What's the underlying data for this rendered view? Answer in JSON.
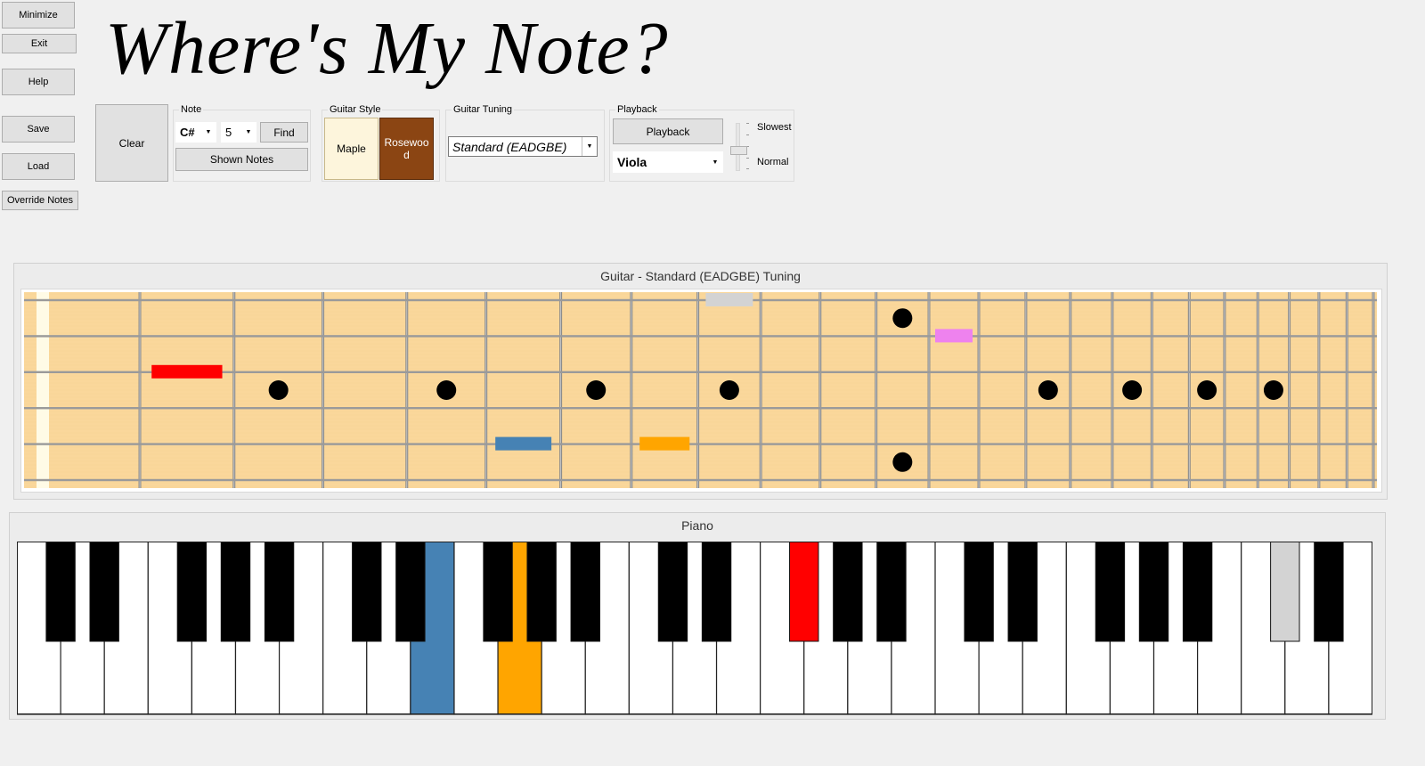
{
  "app_title": "Where's My Note?",
  "side_buttons": {
    "minimize": "Minimize",
    "exit": "Exit",
    "help": "Help",
    "save": "Save",
    "load": "Load",
    "override": "Override Notes"
  },
  "clear_label": "Clear",
  "note_group": {
    "label": "Note",
    "note_value": "C#",
    "octave_value": "5",
    "find_label": "Find",
    "shown_notes_label": "Shown Notes"
  },
  "guitar_style": {
    "label": "Guitar Style",
    "maple_label": "Maple",
    "rosewood_label": "Rosewoo d",
    "maple_color": "#fdf5dc",
    "rosewood_color": "#8b4513"
  },
  "guitar_tuning": {
    "label": "Guitar Tuning",
    "value": "Standard (EADGBE)"
  },
  "playback": {
    "label": "Playback",
    "button_label": "Playback",
    "instrument": "Viola",
    "speed_top": "Slowest",
    "speed_bottom": "Normal",
    "speed_level": 1.0
  },
  "guitar_panel": {
    "title": "Guitar - Standard (EADGBE) Tuning",
    "board_color": "#fad79b",
    "strings": 6,
    "frets": 24,
    "inlay_dots": [
      {
        "fret": 3,
        "gap": 2
      },
      {
        "fret": 5,
        "gap": 2
      },
      {
        "fret": 7,
        "gap": 2
      },
      {
        "fret": 9,
        "gap": 2
      },
      {
        "fret": 12,
        "gap": 0
      },
      {
        "fret": 12,
        "gap": 4
      },
      {
        "fret": 15,
        "gap": 2
      },
      {
        "fret": 17,
        "gap": 2
      },
      {
        "fret": 19,
        "gap": 2
      },
      {
        "fret": 21,
        "gap": 2
      }
    ],
    "note_markers": [
      {
        "string": 0,
        "fret": 9,
        "color": "#d3d3d3"
      },
      {
        "string": 1,
        "fret": 13,
        "color": "#ee82ee"
      },
      {
        "string": 2,
        "fret": 2,
        "color": "#ff0000"
      },
      {
        "string": 4,
        "fret": 6,
        "color": "#4682b4"
      },
      {
        "string": 4,
        "fret": 8,
        "color": "#ffa500"
      }
    ]
  },
  "piano_panel": {
    "title": "Piano",
    "white_keys": 31,
    "highlighted_white": [
      {
        "index": 9,
        "color": "#4682b4"
      },
      {
        "index": 11,
        "color": "#ffa500"
      }
    ],
    "highlighted_black": [
      {
        "index": 12,
        "color": "#ff0000"
      },
      {
        "index": 20,
        "color": "#d3d3d3"
      }
    ]
  }
}
